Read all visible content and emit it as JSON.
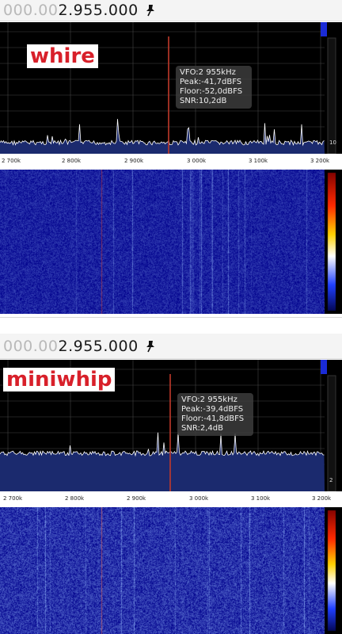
{
  "panels": [
    {
      "frequency": {
        "dim": "000.00",
        "main": "2.955.000"
      },
      "label": "whire",
      "info": {
        "vfo": "VFO:2 955kHz",
        "peak": "Peak:-41,7dBFS",
        "floor": "Floor:-52,0dBFS",
        "snr": "SNR:10,2dB"
      },
      "ticks": [
        "2 700k",
        "2 800k",
        "2 900k",
        "3 000k",
        "3 100k",
        "3 200k"
      ],
      "level_readout": "10",
      "colors": {
        "scale_top": "#1a2bd6",
        "vfo_line": "#c0392b",
        "noise_fill": "#1b2a6e",
        "trace": "#ffffff"
      }
    },
    {
      "frequency": {
        "dim": "000.00",
        "main": "2.955.000"
      },
      "label": "miniwhip",
      "info": {
        "vfo": "VFO:2 955kHz",
        "peak": "Peak:-39,4dBFS",
        "floor": "Floor:-41,8dBFS",
        "snr": "SNR:2,4dB"
      },
      "ticks": [
        "2 700k",
        "2 800k",
        "2 900k",
        "3 000k",
        "3 100k",
        "3 200k"
      ],
      "level_readout": "2",
      "colors": {
        "scale_top": "#1a2bd6",
        "vfo_line": "#c0392b",
        "noise_fill": "#1b2a6e",
        "trace": "#ffffff"
      }
    }
  ]
}
